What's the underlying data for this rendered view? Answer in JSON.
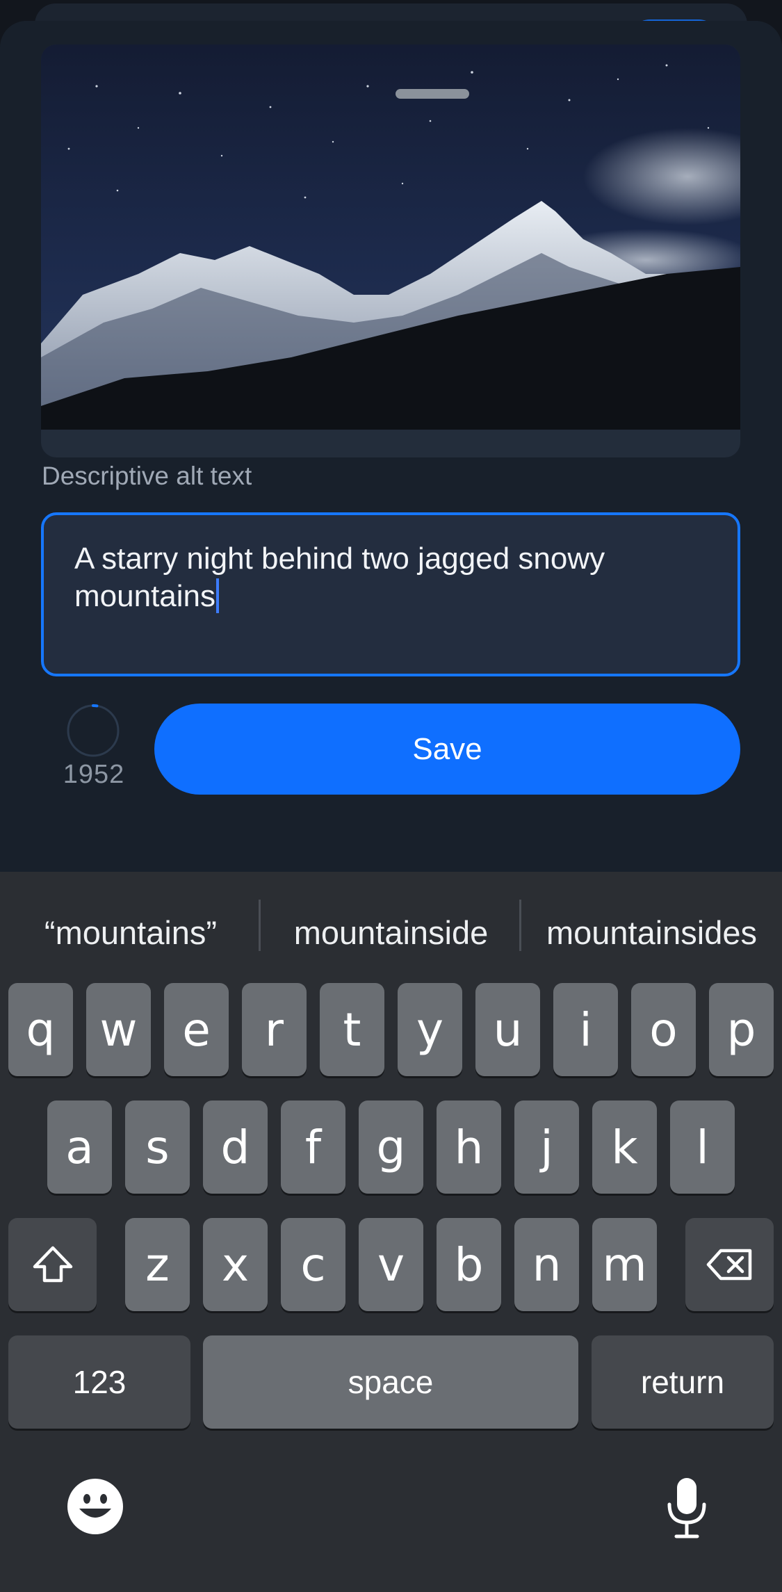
{
  "media": {
    "image_description_icon": "mountain-night-photo"
  },
  "alt_text": {
    "label": "Descriptive alt text",
    "value": "A starry night behind two jagged snowy mountains"
  },
  "counter": {
    "remaining": "1952",
    "fraction_used": 0.024
  },
  "save_button": {
    "label": "Save"
  },
  "keyboard": {
    "suggestions": [
      "“mountains”",
      "mountainside",
      "mountainsides"
    ],
    "row1": [
      "q",
      "w",
      "e",
      "r",
      "t",
      "y",
      "u",
      "i",
      "o",
      "p"
    ],
    "row2": [
      "a",
      "s",
      "d",
      "f",
      "g",
      "h",
      "j",
      "k",
      "l"
    ],
    "row3": [
      "z",
      "x",
      "c",
      "v",
      "b",
      "n",
      "m"
    ],
    "numbers_label": "123",
    "space_label": "space",
    "return_label": "return",
    "icons": [
      "shift-icon",
      "backspace-icon",
      "emoji-icon",
      "microphone-icon"
    ]
  },
  "colors": {
    "accent": "#0f6fff",
    "field_border": "#1677ff",
    "sheet_bg": "#18202b",
    "keyboard_bg": "#2b2e33"
  }
}
